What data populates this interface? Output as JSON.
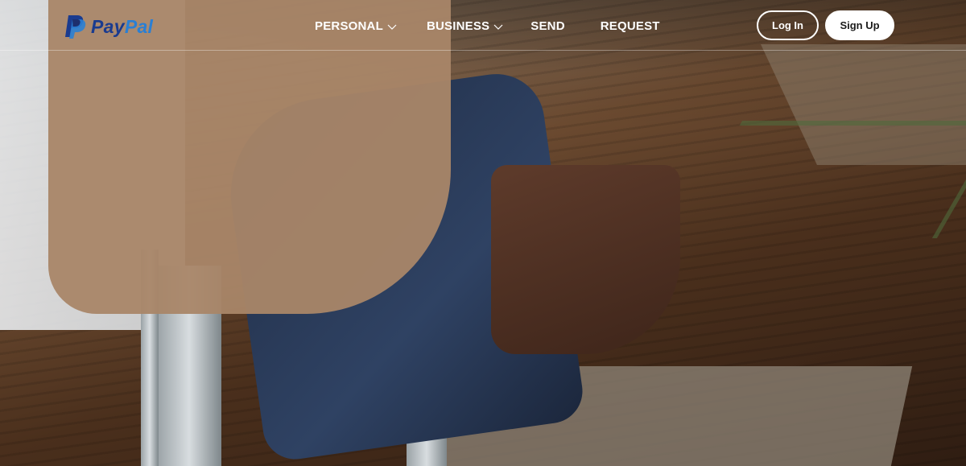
{
  "brand": {
    "name_part1": "Pay",
    "name_part2": "Pal",
    "colors": {
      "dark_blue": "#1a3b8f",
      "light_blue": "#2a7fd4"
    }
  },
  "nav": {
    "items": [
      {
        "label": "PERSONAL",
        "has_dropdown": true
      },
      {
        "label": "BUSINESS",
        "has_dropdown": true
      },
      {
        "label": "SEND",
        "has_dropdown": false
      },
      {
        "label": "REQUEST",
        "has_dropdown": false
      }
    ]
  },
  "actions": {
    "login_label": "Log In",
    "signup_label": "Sign Up"
  },
  "icons": {
    "logo": "paypal-logo-icon",
    "dropdown": "chevron-down-icon"
  }
}
